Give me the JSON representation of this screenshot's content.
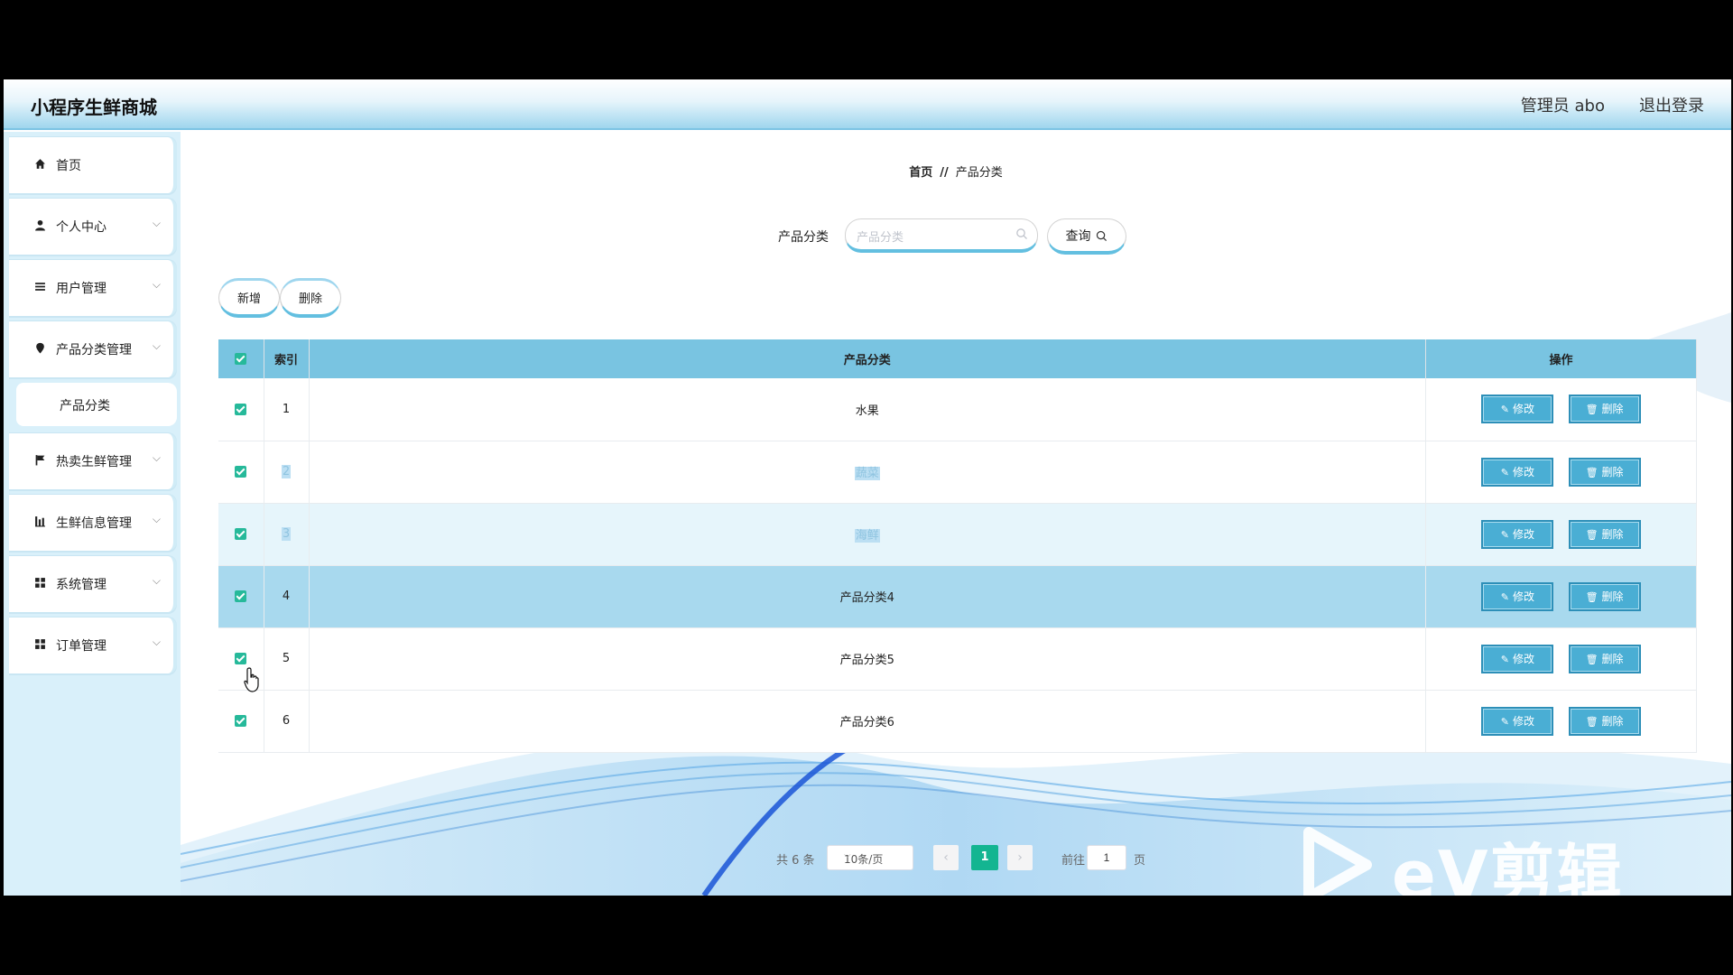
{
  "header": {
    "title": "小程序生鲜商城",
    "admin": "管理员 abo",
    "logout": "退出登录"
  },
  "sidebar": {
    "items": [
      {
        "label": "首页",
        "icon": "home-icon"
      },
      {
        "label": "个人中心",
        "icon": "user-icon"
      },
      {
        "label": "用户管理",
        "icon": "list-icon"
      },
      {
        "label": "产品分类管理",
        "icon": "pin-icon"
      },
      {
        "label": "热卖生鲜管理",
        "icon": "flag-icon"
      },
      {
        "label": "生鲜信息管理",
        "icon": "chart-icon"
      },
      {
        "label": "系统管理",
        "icon": "grid-icon"
      },
      {
        "label": "订单管理",
        "icon": "grid-icon"
      }
    ],
    "sub_item": "产品分类"
  },
  "breadcrumb": {
    "home": "首页",
    "sep": "//",
    "current": "产品分类"
  },
  "search": {
    "label": "产品分类",
    "placeholder": "产品分类",
    "button": "查询"
  },
  "toolbar": {
    "add": "新增",
    "delete": "删除"
  },
  "table": {
    "headers": {
      "index": "索引",
      "category": "产品分类",
      "ops": "操作"
    },
    "rows": [
      {
        "index": "1",
        "category": "水果"
      },
      {
        "index": "2",
        "category": "蔬菜"
      },
      {
        "index": "3",
        "category": "海鲜"
      },
      {
        "index": "4",
        "category": "产品分类4"
      },
      {
        "index": "5",
        "category": "产品分类5"
      },
      {
        "index": "6",
        "category": "产品分类6"
      }
    ],
    "edit_label": "修改",
    "delete_label": "删除"
  },
  "pagination": {
    "total": "共 6 条",
    "page_size": "10条/页",
    "current_page": "1",
    "goto": "前往",
    "goto_value": "1",
    "unit": "页"
  },
  "watermark": "eV剪辑",
  "colors": {
    "accent": "#79c4e1",
    "check": "#26b99a",
    "page_active": "#13b591",
    "op_button": "#4aaed4"
  }
}
